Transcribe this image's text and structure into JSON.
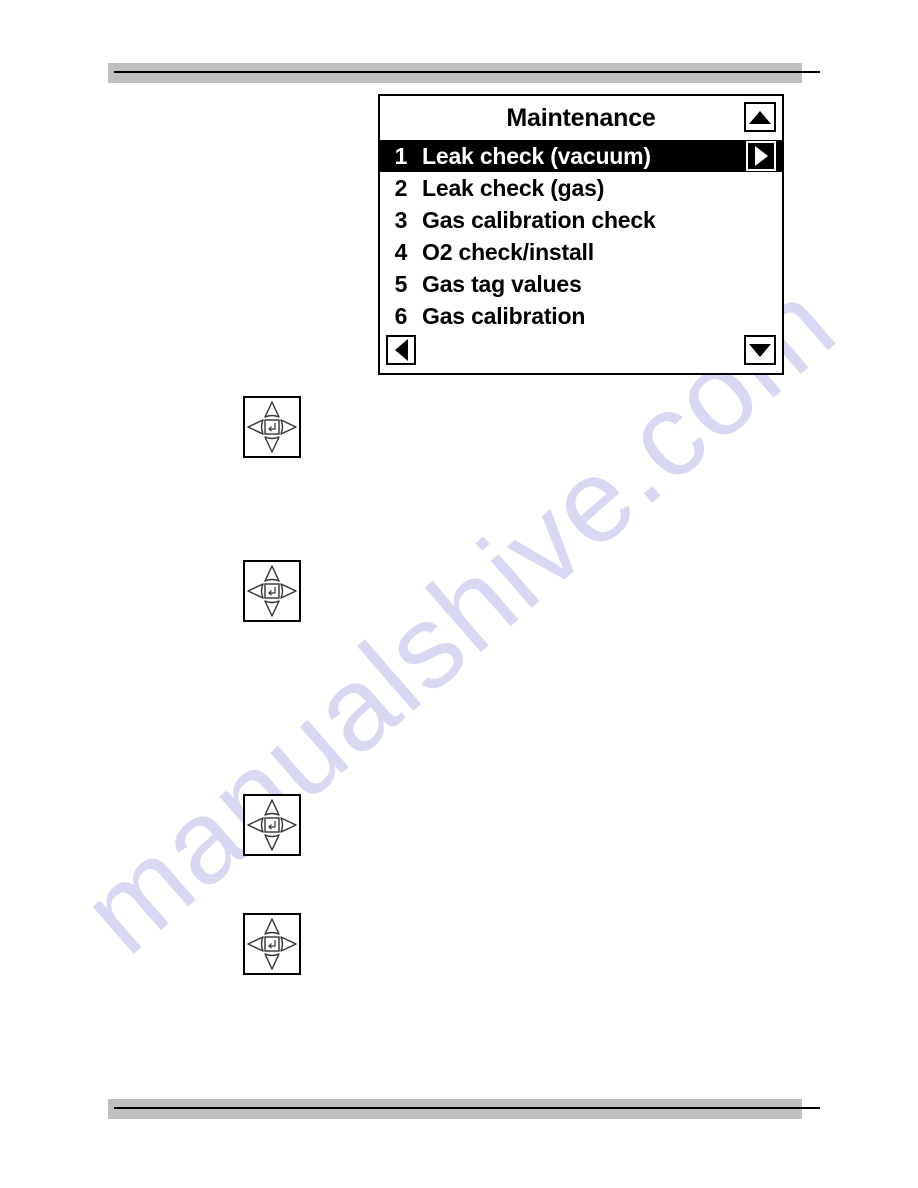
{
  "page": {
    "watermark_text": "manualshive.com",
    "watermark_color": "#d8d8f2",
    "rule_color": "#c0c0c0",
    "rule_line_color": "#000000"
  },
  "lcd": {
    "title": "Maintenance",
    "scroll_up_icon": "triangle-up-icon",
    "scroll_down_icon": "triangle-down-icon",
    "back_icon": "triangle-left-icon",
    "enter_icon": "triangle-right-icon",
    "selected_index": 0,
    "items": [
      {
        "number": "1",
        "label": "Leak check (vacuum)"
      },
      {
        "number": "2",
        "label": "Leak check (gas)"
      },
      {
        "number": "3",
        "label": "Gas calibration check"
      },
      {
        "number": "4",
        "label": "O2 check/install"
      },
      {
        "number": "5",
        "label": "Gas tag values"
      },
      {
        "number": "6",
        "label": "Gas calibration"
      }
    ]
  },
  "keypads": [
    {
      "name": "navigation-keypad-1",
      "icon": "dpad-icon"
    },
    {
      "name": "navigation-keypad-2",
      "icon": "dpad-icon"
    },
    {
      "name": "navigation-keypad-3",
      "icon": "dpad-icon"
    },
    {
      "name": "navigation-keypad-4",
      "icon": "dpad-icon"
    }
  ]
}
